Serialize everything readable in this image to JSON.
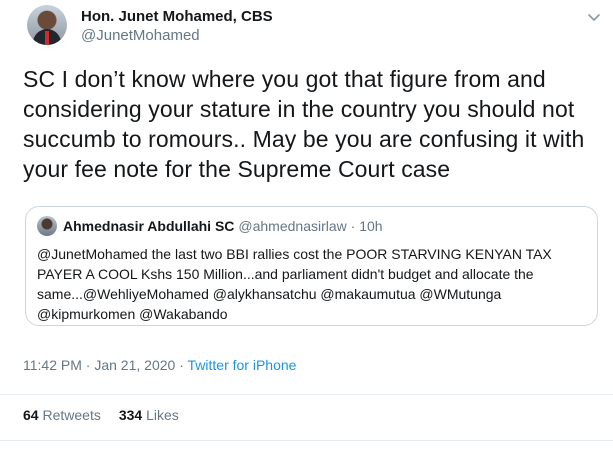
{
  "author": {
    "display_name": "Hon. Junet Mohamed, CBS",
    "handle": "@JunetMohamed",
    "avatar_icon": "profile-photo"
  },
  "tweet": {
    "text": "SC I don’t know where you got that figure from and considering your stature in the country you should not succumb to romours.. May be you are confusing it with your fee note for the Supreme Court case"
  },
  "quoted_tweet": {
    "display_name": "Ahmednasir Abdullahi SC",
    "handle": "@ahmednasirlaw",
    "separator": " · ",
    "time": "10h",
    "text": "@JunetMohamed the last two BBI rallies cost the POOR STARVING KENYAN TAX PAYER A COOL Kshs 150 Million...and parliament didn't budget and allocate the same...@WehliyeMohamed @alykhansatchu @makaumutua @WMutunga @kipmurkomen @Wakabando"
  },
  "meta": {
    "time": "11:42 PM",
    "separator1": " · ",
    "date": "Jan 21, 2020",
    "separator2": " · ",
    "source": "Twitter for iPhone"
  },
  "stats": {
    "retweets_count": "64",
    "retweets_label": "Retweets",
    "likes_count": "334",
    "likes_label": "Likes"
  },
  "colors": {
    "link": "#1b95e0",
    "secondary_text": "#657786",
    "primary_text": "#14171a",
    "border": "#ccd6dd"
  }
}
